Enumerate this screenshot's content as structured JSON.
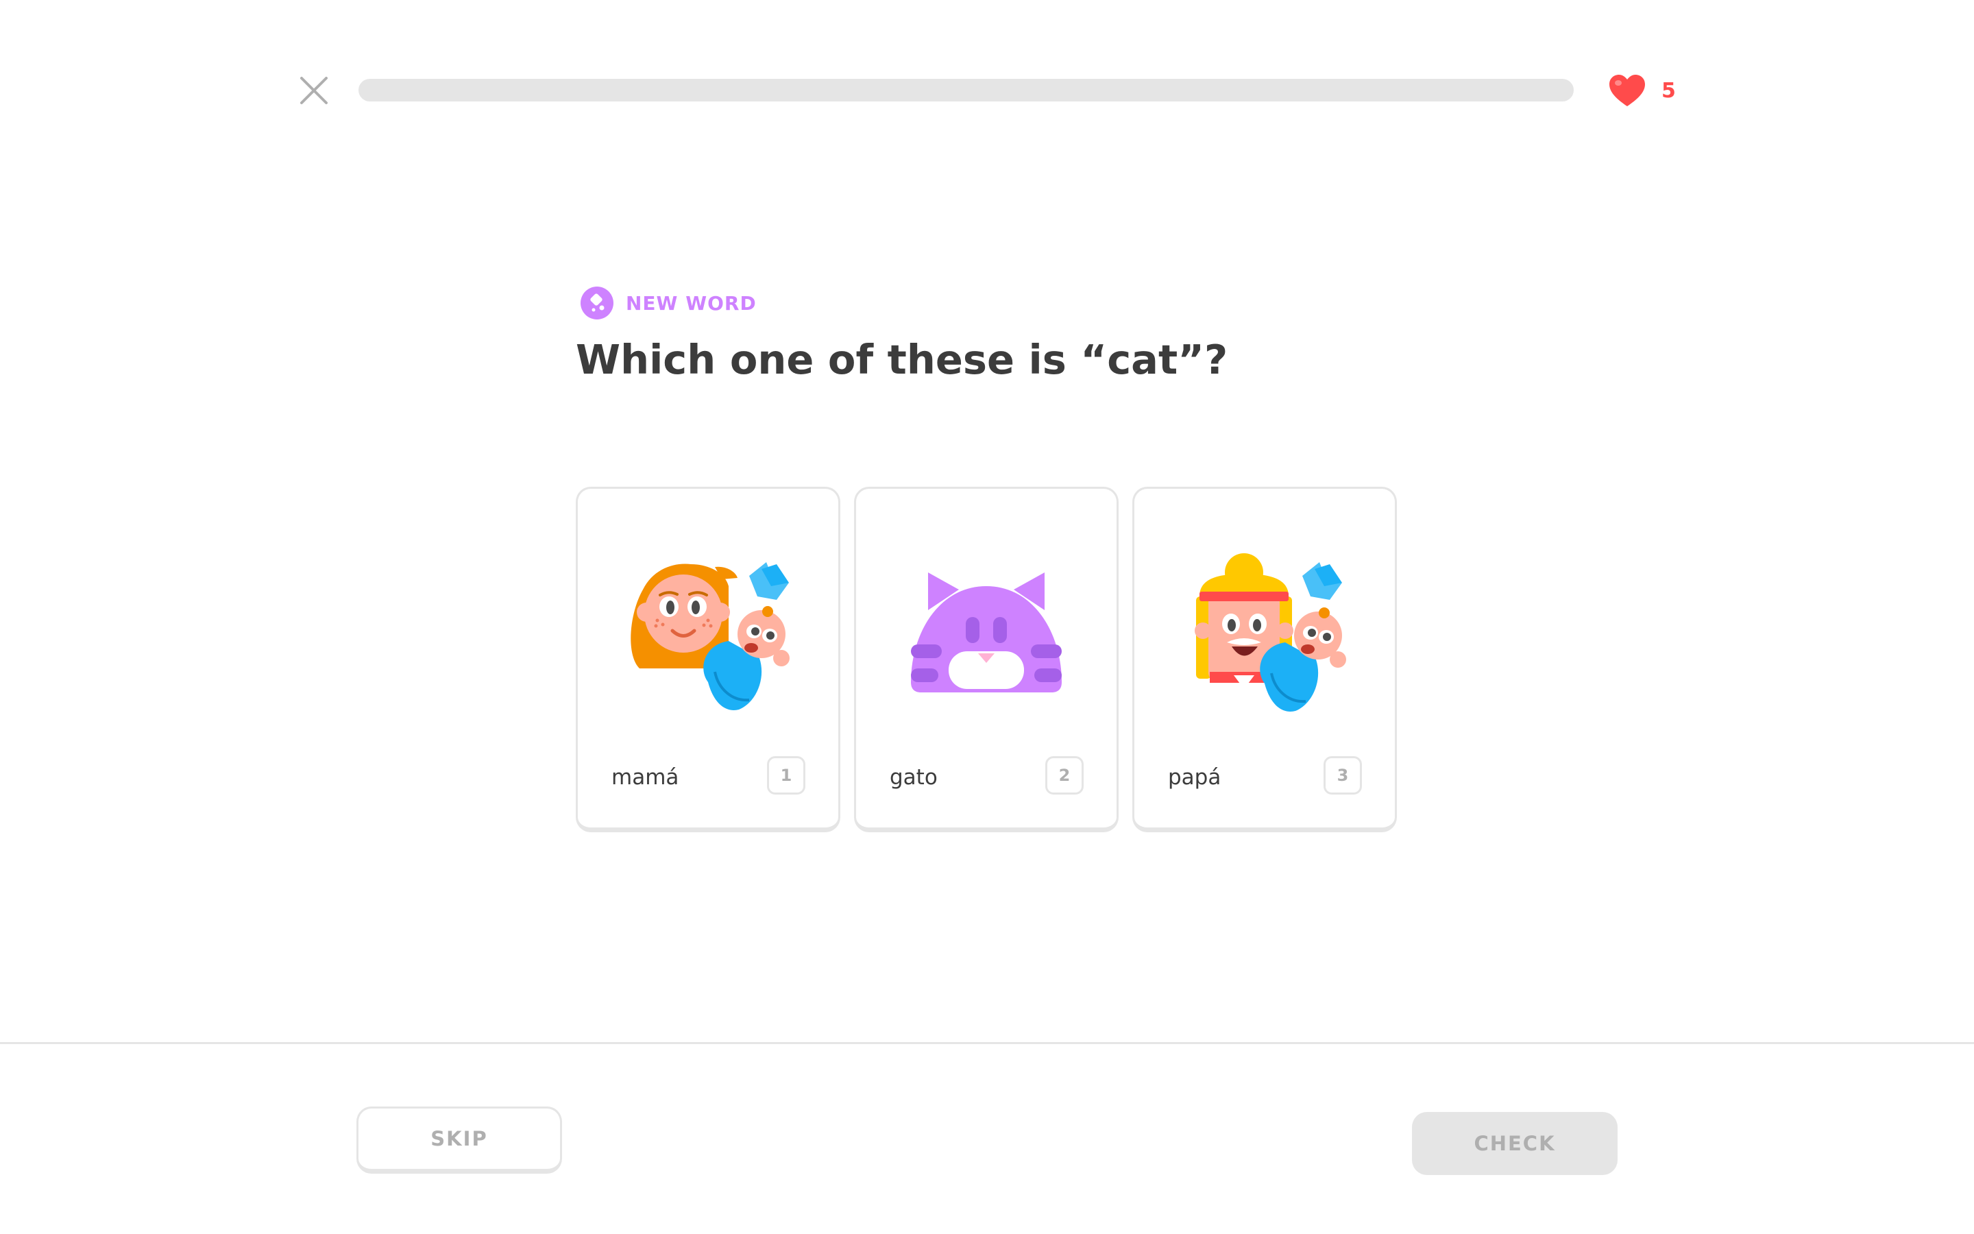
{
  "header": {
    "progress_percent": 0,
    "hearts_count": "5"
  },
  "challenge": {
    "tag_label": "NEW WORD",
    "prompt": "Which one of these is “cat”?"
  },
  "choices": [
    {
      "word": "mamá",
      "key": "1",
      "illustration": "mother-with-baby"
    },
    {
      "word": "gato",
      "key": "2",
      "illustration": "cat"
    },
    {
      "word": "papá",
      "key": "3",
      "illustration": "father-with-baby"
    }
  ],
  "footer": {
    "skip_label": "SKIP",
    "check_label": "CHECK"
  },
  "colors": {
    "heart": "#ff4b4b",
    "tag": "#ce82ff",
    "progress_track": "#e5e5e5",
    "border": "#e5e5e5",
    "muted_text": "#afafaf",
    "text": "#3c3c3c"
  }
}
